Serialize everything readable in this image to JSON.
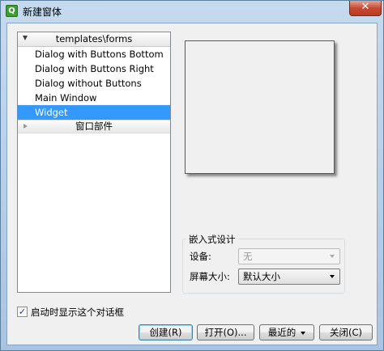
{
  "window": {
    "title": "新建窗体",
    "app_icon_glyph": "Q",
    "close_glyph": "✕"
  },
  "tree": {
    "group1_header": "templates\\forms",
    "group1_expanded": true,
    "items": [
      {
        "label": "Dialog with Buttons Bottom",
        "selected": false
      },
      {
        "label": "Dialog with Buttons Right",
        "selected": false
      },
      {
        "label": "Dialog without Buttons",
        "selected": false
      },
      {
        "label": "Main Window",
        "selected": false
      },
      {
        "label": "Widget",
        "selected": true
      }
    ],
    "group2_header": "窗口部件",
    "group2_expanded": false
  },
  "embedded_design": {
    "title": "嵌入式设计",
    "device_label": "设备:",
    "device_value": "无",
    "device_enabled": false,
    "screen_size_label": "屏幕大小:",
    "screen_size_value": "默认大小"
  },
  "footer": {
    "show_dialog_on_startup_label": "启动时显示这个对话框",
    "show_dialog_on_startup_checked": true,
    "check_glyph": "✓",
    "buttons": {
      "create": "创建(R)",
      "open": "打开(O)...",
      "recent": "最近的",
      "close": "关闭(C)"
    }
  },
  "colors": {
    "selection": "#3399ff",
    "titlebar": "#c6daee",
    "close_button": "#c74b32"
  }
}
